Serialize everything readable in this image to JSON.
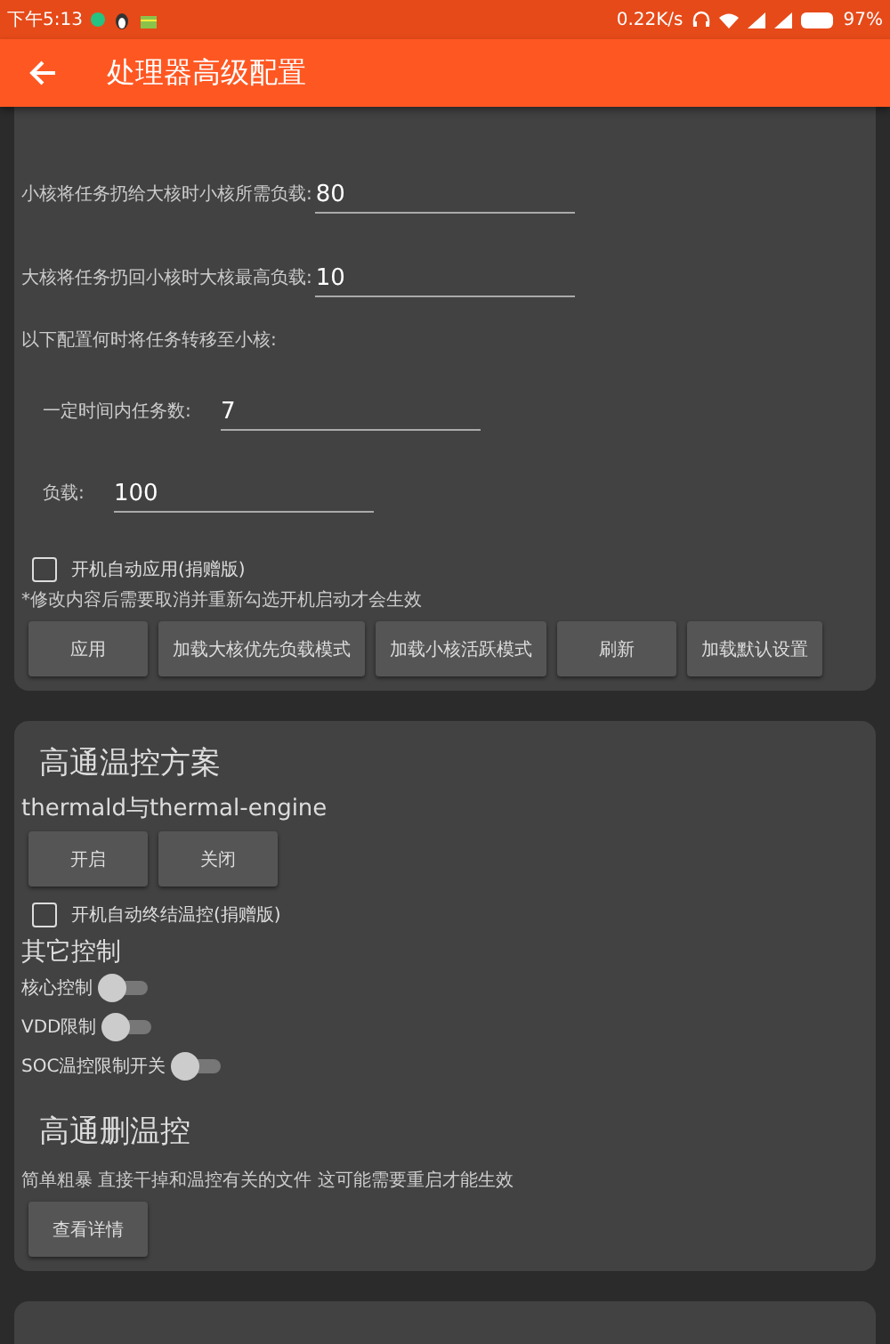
{
  "status_bar": {
    "time": "下午5:13",
    "speed": "0.22K/s",
    "battery": "97%"
  },
  "app_bar": {
    "title": "处理器高级配置"
  },
  "load_balance": {
    "fields": [
      {
        "label": "小核将任务扔给大核时小核所需负载:",
        "value": "80"
      },
      {
        "label": "大核将任务扔回小核时大核最高负载:",
        "value": "10"
      }
    ],
    "sub_heading": "以下配置何时将任务转移至小核:",
    "sub_fields": [
      {
        "label": "一定时间内任务数:",
        "value": "7"
      },
      {
        "label": "负载:",
        "value": "100"
      }
    ],
    "autostart": {
      "label": "开机自动应用(捐赠版)",
      "checked": false
    },
    "note": "*修改内容后需要取消并重新勾选开机启动才会生效",
    "buttons": [
      "应用",
      "加载大核优先负载模式",
      "加载小核活跃模式",
      "刷新",
      "加载默认设置"
    ]
  },
  "thermal": {
    "title": "高通温控方案",
    "subtitle": "thermald与thermal-engine",
    "buttons": [
      "开启",
      "关闭"
    ],
    "autostop": {
      "label": "开机自动终结温控(捐赠版)",
      "checked": false
    },
    "other_heading": "其它控制",
    "toggles": [
      {
        "label": "核心控制",
        "on": false
      },
      {
        "label": "VDD限制",
        "on": false
      },
      {
        "label": "SOC温控限制开关",
        "on": false
      }
    ],
    "delete_title": "高通删温控",
    "delete_desc": "简单粗暴 直接干掉和温控有关的文件 这可能需要重启才能生效",
    "details_button": "查看详情"
  }
}
